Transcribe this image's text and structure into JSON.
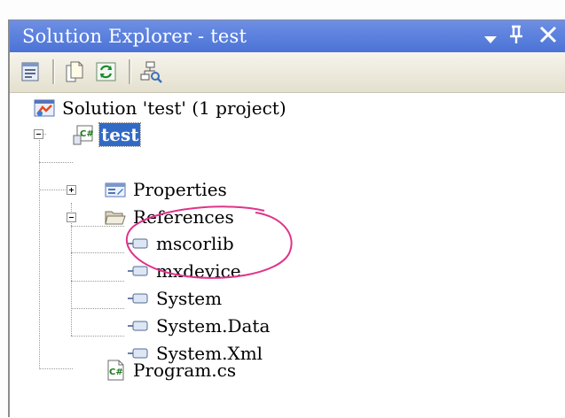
{
  "window": {
    "title": "Solution Explorer - test",
    "accent_color": "#4b73d6",
    "controls": {
      "dropdown_icon": "dropdown-arrow-icon",
      "pin_glyph": "Ԅ",
      "close_glyph": "✕"
    }
  },
  "toolbar": {
    "buttons": [
      {
        "name": "properties-button",
        "icon": "properties-icon"
      },
      {
        "name": "show-all-files-button",
        "icon": "show-all-files-icon"
      },
      {
        "name": "refresh-button",
        "icon": "refresh-icon"
      },
      {
        "name": "view-class-diagram-button",
        "icon": "class-diagram-icon"
      }
    ]
  },
  "tree": {
    "solution": {
      "label": "Solution 'test' (1 project)",
      "icon": "solution-icon"
    },
    "project": {
      "label": "test",
      "icon": "csharp-project-icon",
      "expanded": true,
      "selected": true
    },
    "properties": {
      "label": "Properties",
      "icon": "properties-folder-icon",
      "expanded": false
    },
    "references": {
      "label": "References",
      "icon": "folder-open-icon",
      "expanded": true,
      "items": [
        {
          "label": "mscorlib",
          "icon": "reference-icon"
        },
        {
          "label": "mxdevice",
          "icon": "reference-icon"
        },
        {
          "label": "System",
          "icon": "reference-icon"
        },
        {
          "label": "System.Data",
          "icon": "reference-icon"
        },
        {
          "label": "System.Xml",
          "icon": "reference-icon"
        }
      ]
    },
    "program": {
      "label": "Program.cs",
      "icon": "csharp-file-icon"
    }
  },
  "annotation": {
    "shape": "ellipse",
    "color": "#e0338a"
  }
}
